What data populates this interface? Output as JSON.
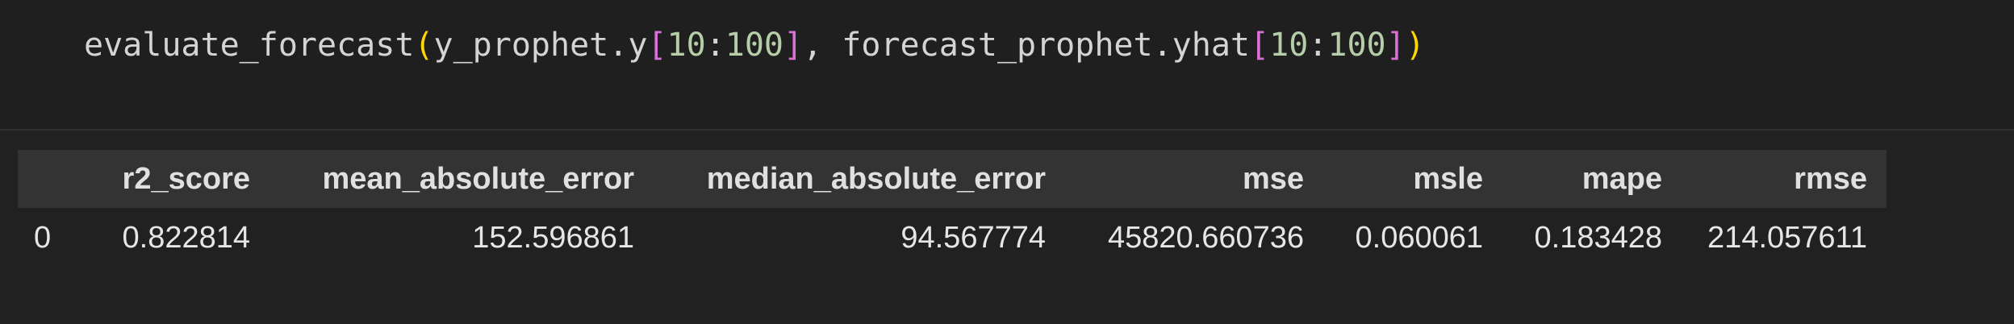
{
  "code_cell": {
    "tokens": {
      "fn": "evaluate_forecast",
      "lparen": "(",
      "arg1_obj": "y_prophet.y",
      "lbr1": "[",
      "slice1_start": "10",
      "colon1": ":",
      "slice1_end": "100",
      "rbr1": "]",
      "sep": ", ",
      "arg2_obj": "forecast_prophet.yhat",
      "lbr2": "[",
      "slice2_start": "10",
      "colon2": ":",
      "slice2_end": "100",
      "rbr2": "]",
      "rparen": ")"
    }
  },
  "output_table": {
    "columns": [
      "",
      "r2_score",
      "mean_absolute_error",
      "median_absolute_error",
      "mse",
      "msle",
      "mape",
      "rmse"
    ],
    "rows": [
      [
        "0",
        "0.822814",
        "152.596861",
        "94.567774",
        "45820.660736",
        "0.060061",
        "0.183428",
        "214.057611"
      ]
    ]
  },
  "colors": {
    "background": "#1f1f1f",
    "table_header_bg": "#333333",
    "paren": "#ffd700",
    "bracket": "#da70d6",
    "number": "#b5cea8"
  }
}
